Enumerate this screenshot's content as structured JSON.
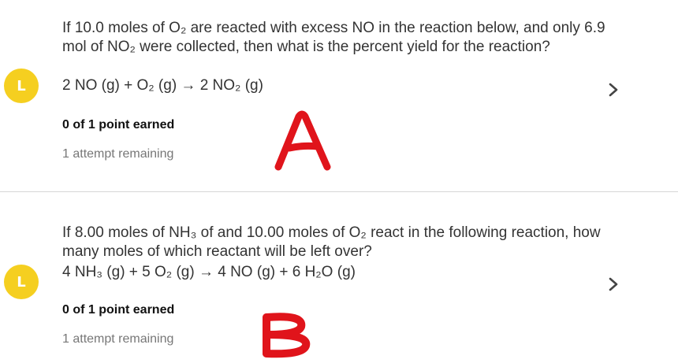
{
  "questions": [
    {
      "status_icon_letter": "L",
      "text": "If 10.0 moles of O₂ are reacted with excess NO in the reaction below, and only 6.9 mol of NO₂ were collected, then what is the percent yield for the reaction?",
      "equation": "2 NO (g) + O₂ (g) → 2 NO₂ (g)",
      "points": "0 of 1 point earned",
      "attempts": "1 attempt remaining",
      "handwritten_mark": "A"
    },
    {
      "status_icon_letter": "L",
      "text": "If 8.00 moles of NH₃ of and 10.00 moles of O₂ react in the following reaction, how many moles of which reactant will be left over?",
      "equation": "4 NH₃ (g) + 5 O₂ (g) → 4 NO (g) + 6 H₂O (g)",
      "points": "0 of 1 point earned",
      "attempts": "1 attempt remaining",
      "handwritten_mark": "B"
    }
  ],
  "colors": {
    "status_icon": "#f5cf20",
    "handwriting": "#e0141b",
    "divider": "#d6d6d6",
    "text": "#333333",
    "muted": "#777777"
  },
  "icons": {
    "status": "late-icon",
    "expand": "chevron-right-icon"
  }
}
